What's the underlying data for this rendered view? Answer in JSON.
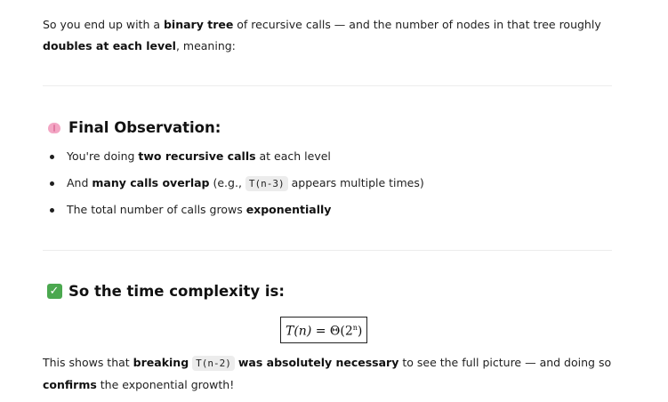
{
  "intro": {
    "t1": "So you end up with a ",
    "b1": "binary tree",
    "t2": " of recursive calls — and the number of nodes in that tree roughly ",
    "b2": "doubles at each level",
    "t3": ", meaning:"
  },
  "observation": {
    "heading": "Final Observation:",
    "icon": "brain-icon",
    "bullets": [
      {
        "t1": "You're doing ",
        "b1": "two recursive calls",
        "t2": " at each level"
      },
      {
        "t1": "And ",
        "b1": "many calls overlap",
        "t2": " (e.g., ",
        "code": "T(n-3)",
        "t3": " appears multiple times)"
      },
      {
        "t1": "The total number of calls grows ",
        "b1": "exponentially"
      }
    ]
  },
  "complexity": {
    "heading": "So the time complexity is:",
    "icon": "check-mark-icon",
    "icon_color": "#4ba84f",
    "formula": {
      "lhs": "T(n)",
      "eq": " = Θ(2",
      "exp": "n",
      "rhs": ")"
    }
  },
  "conclusion": {
    "t1": "This shows that ",
    "b1": "breaking",
    "code": "T(n-2)",
    "b2": "was absolutely necessary",
    "t2": " to see the full picture — and doing so ",
    "b3": "confirms",
    "t3": " the exponential growth!"
  }
}
